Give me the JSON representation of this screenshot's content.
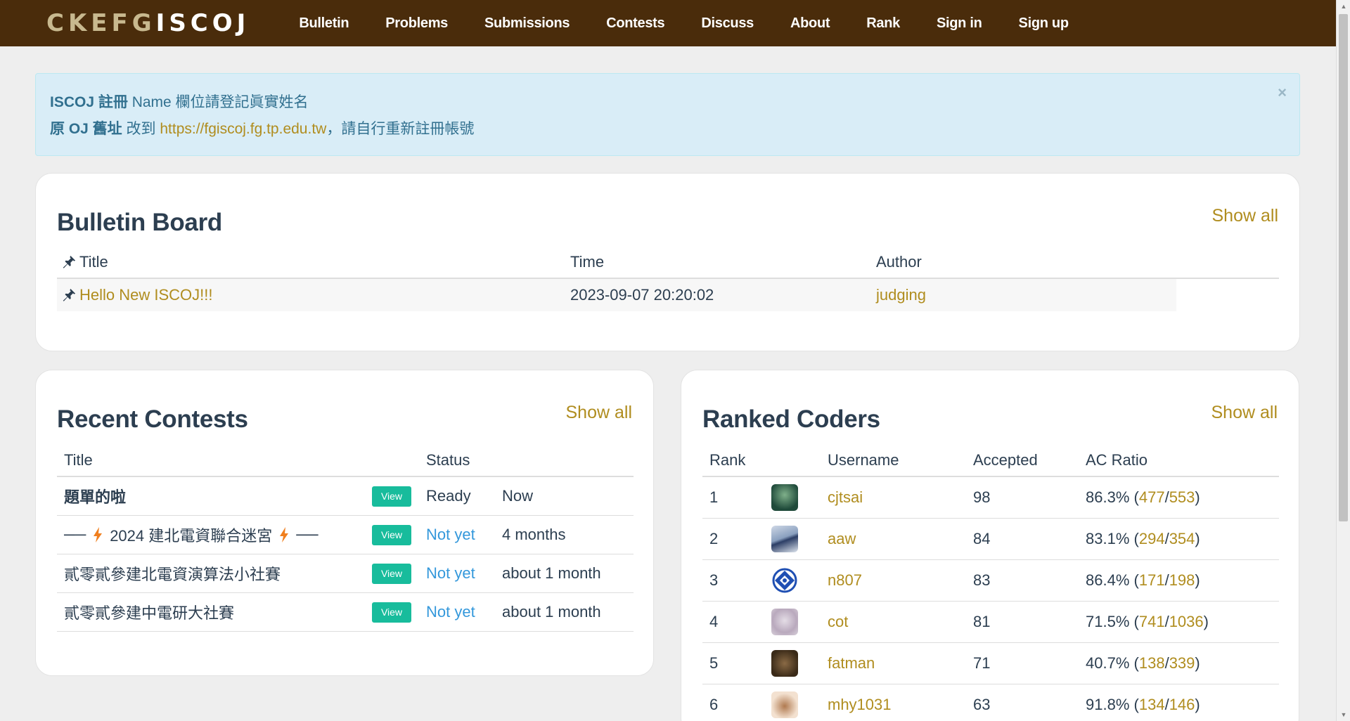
{
  "brand": {
    "part1": "CKEFG",
    "part2": "ISCOJ"
  },
  "nav": [
    "Bulletin",
    "Problems",
    "Submissions",
    "Contests",
    "Discuss",
    "About",
    "Rank",
    "Sign in",
    "Sign up"
  ],
  "alert": {
    "line1_bold": "ISCOJ 註冊",
    "line1_text": " Name 欄位請登記眞實姓名",
    "line2_bold": "原 OJ 舊址",
    "line2_pre": " 改到 ",
    "line2_link": "https://fgiscoj.fg.tp.edu.tw",
    "line2_post": "，請自行重新註冊帳號",
    "close": "×"
  },
  "bulletin": {
    "title": "Bulletin Board",
    "show_all": "Show all",
    "headers": {
      "title": "Title",
      "time": "Time",
      "author": "Author"
    },
    "rows": [
      {
        "title": "Hello New ISCOJ!!!",
        "time": "2023-09-07 20:20:02",
        "author": "judging"
      }
    ]
  },
  "contests": {
    "title": "Recent Contests",
    "show_all": "Show all",
    "headers": {
      "title": "Title",
      "status": "Status"
    },
    "view_label": "View",
    "rows": [
      {
        "title": "題單的啦",
        "status": "Ready",
        "time": "Now"
      },
      {
        "title_pre": "──",
        "title": "2024 建北電資聯合迷宮",
        "title_post": "──",
        "status": "Not yet",
        "time": "4 months"
      },
      {
        "title": "貳零貳參建北電資演算法小社賽",
        "status": "Not yet",
        "time": "about 1 month"
      },
      {
        "title": "貳零貳參建中電研大社賽",
        "status": "Not yet",
        "time": "about 1 month"
      }
    ]
  },
  "ranked": {
    "title": "Ranked Coders",
    "show_all": "Show all",
    "headers": {
      "rank": "Rank",
      "username": "Username",
      "accepted": "Accepted",
      "ratio": "AC Ratio"
    },
    "rows": [
      {
        "rank": "1",
        "username": "cjtsai",
        "accepted": "98",
        "ratio": "86.3%",
        "ac": "477",
        "total": "553"
      },
      {
        "rank": "2",
        "username": "aaw",
        "accepted": "84",
        "ratio": "83.1%",
        "ac": "294",
        "total": "354"
      },
      {
        "rank": "3",
        "username": "n807",
        "accepted": "83",
        "ratio": "86.4%",
        "ac": "171",
        "total": "198"
      },
      {
        "rank": "4",
        "username": "cot",
        "accepted": "81",
        "ratio": "71.5%",
        "ac": "741",
        "total": "1036"
      },
      {
        "rank": "5",
        "username": "fatman",
        "accepted": "71",
        "ratio": "40.7%",
        "ac": "138",
        "total": "339"
      },
      {
        "rank": "6",
        "username": "mhy1031",
        "accepted": "63",
        "ratio": "91.8%",
        "ac": "134",
        "total": "146"
      }
    ]
  },
  "colors": {
    "navbar": "#4a2c0b",
    "link": "#b08d1f",
    "accent": "#18bc9c",
    "alert_bg": "#d9edf7"
  }
}
